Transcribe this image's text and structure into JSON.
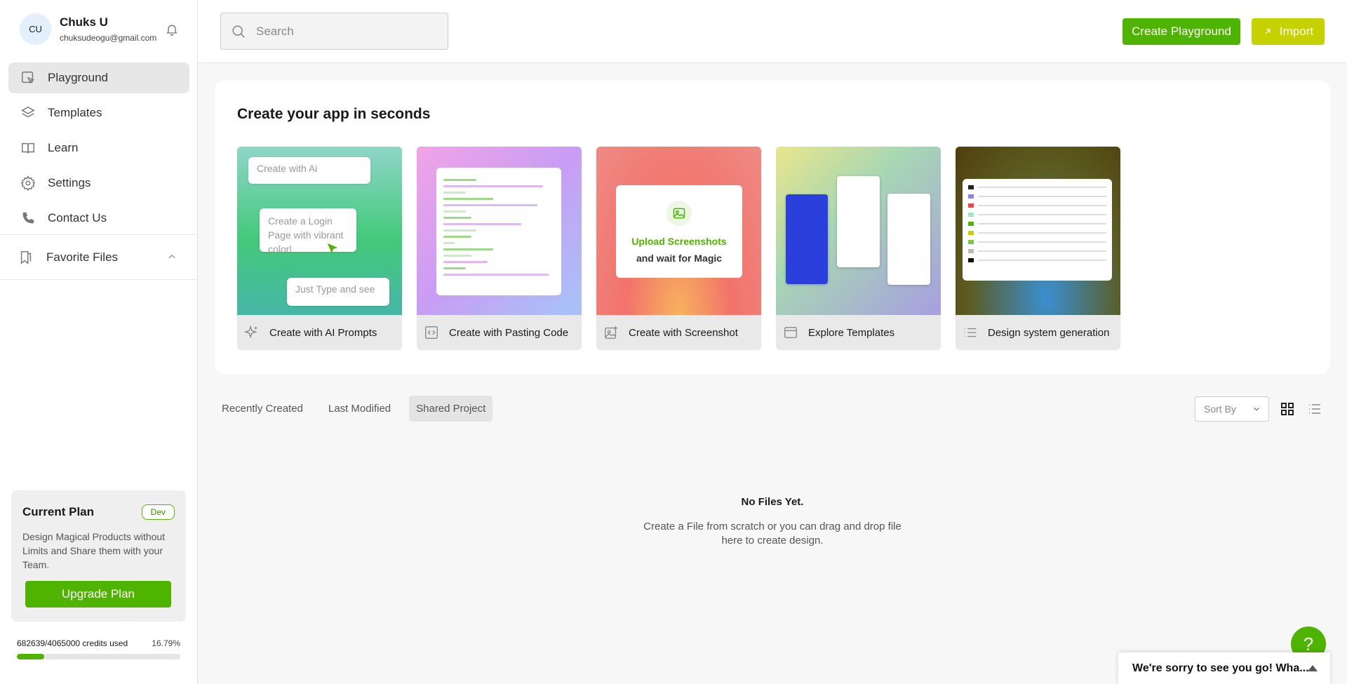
{
  "profile": {
    "initials": "CU",
    "name": "Chuks U",
    "email": "chuksudeogu@gmail.com"
  },
  "nav": [
    {
      "label": "Playground",
      "icon": "playground-icon",
      "active": true
    },
    {
      "label": "Templates",
      "icon": "layers-icon",
      "active": false
    },
    {
      "label": "Learn",
      "icon": "book-icon",
      "active": false
    },
    {
      "label": "Settings",
      "icon": "gear-icon",
      "active": false
    },
    {
      "label": "Contact Us",
      "icon": "phone-icon",
      "active": false
    }
  ],
  "favorites": {
    "label": "Favorite Files"
  },
  "plan": {
    "title": "Current Plan",
    "badge": "Dev",
    "description": "Design Magical Products without Limits and Share them with your Team.",
    "upgrade_label": "Upgrade Plan"
  },
  "credits": {
    "text": "682639/4065000 credits used",
    "percent_text": "16.79%",
    "fraction": 0.1679
  },
  "search": {
    "placeholder": "Search",
    "value": ""
  },
  "header": {
    "create_label": "Create Playground",
    "import_label": "Import"
  },
  "panel": {
    "title": "Create your app in seconds",
    "cards": [
      {
        "label": "Create with AI Prompts",
        "icon": "sparkle-icon"
      },
      {
        "label": "Create with Pasting Code",
        "icon": "code-icon"
      },
      {
        "label": "Create with Screenshot",
        "icon": "image-icon"
      },
      {
        "label": "Explore Templates",
        "icon": "window-icon"
      },
      {
        "label": "Design system generation",
        "icon": "list-icon"
      }
    ],
    "ai_card": {
      "box1": "Create with Ai",
      "box2": "Create a Login Page with vibrant color|",
      "box3": "Just Type and see"
    },
    "screenshot_card": {
      "line1": "Upload Screenshots",
      "line2": "and wait for Magic"
    }
  },
  "tabs": [
    {
      "label": "Recently Created",
      "active": false
    },
    {
      "label": "Last Modified",
      "active": false
    },
    {
      "label": "Shared Project",
      "active": true
    }
  ],
  "sort": {
    "label": "Sort By"
  },
  "empty": {
    "title": "No Files Yet.",
    "description": "Create a File from scratch or you can drag and drop file here to create design."
  },
  "help": {
    "label": "?"
  },
  "feedback": {
    "label": "We're sorry to see you go! Wha..."
  },
  "colors": {
    "accent": "#4fb400",
    "import": "#c5d200"
  }
}
